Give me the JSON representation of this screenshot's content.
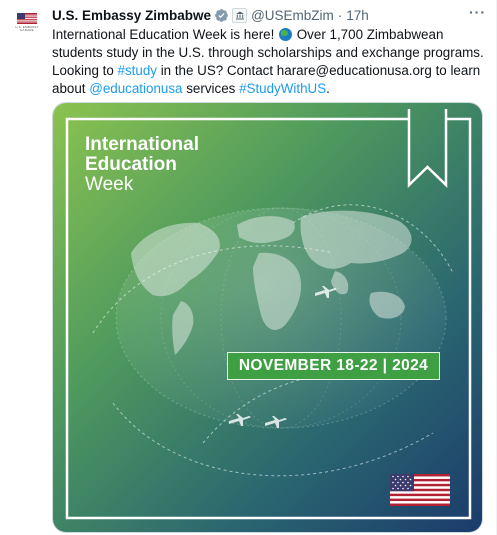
{
  "tweet": {
    "display_name": "U.S. Embassy Zimbabwe",
    "handle": "@USEmbZim",
    "separator": "·",
    "time": "17h",
    "more_label": "···",
    "avatar_caption": "U.S. EMBASSY HARARE",
    "text": {
      "part1": "International Education Week is here! ",
      "part2": " Over 1,700 Zimbabwean students study in the U.S. through scholarships and exchange programs. Looking to ",
      "hashtag_study": "#study",
      "part3": " in the US? Contact harare@educationusa.org to learn about ",
      "mention": "@educationusa",
      "part4": " services ",
      "hashtag_studywithus": "#StudyWithUS",
      "part5": "."
    }
  },
  "poster": {
    "title_line1": "International",
    "title_line2": "Education",
    "title_line3": "Week",
    "date_banner": "NOVEMBER 18-22 | 2024"
  },
  "icons": {
    "verified": "verified-badge-icon",
    "government": "government-badge-icon",
    "globe": "globe-emoji-icon",
    "flag": "us-flag-icon"
  },
  "colors": {
    "link": "#1d9bf0",
    "verified": "#829aab",
    "poster_green": "#7bbf4a",
    "poster_navy": "#1c3f6e",
    "banner_green": "#3ea043"
  }
}
